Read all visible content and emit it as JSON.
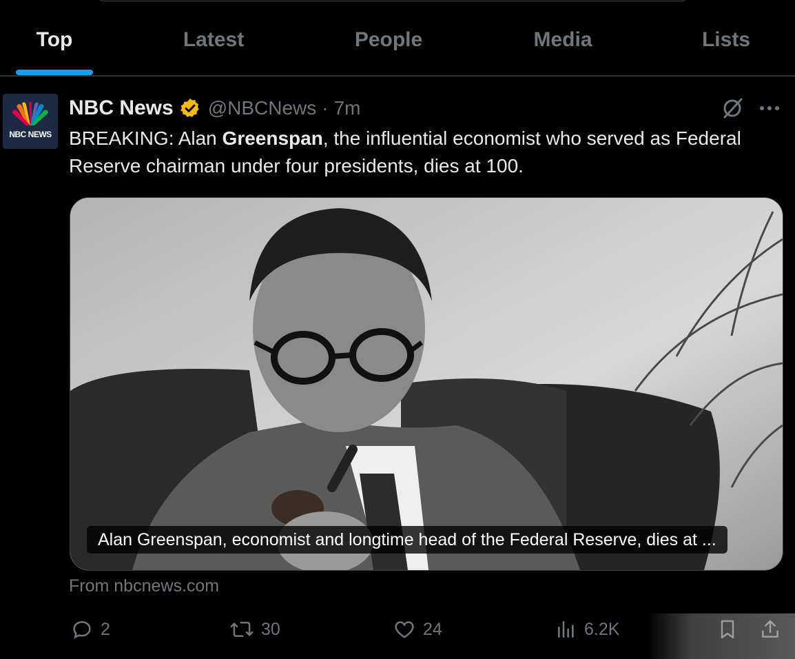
{
  "tabs": [
    {
      "label": "Top",
      "active": true
    },
    {
      "label": "Latest",
      "active": false
    },
    {
      "label": "People",
      "active": false
    },
    {
      "label": "Media",
      "active": false
    },
    {
      "label": "Lists",
      "active": false
    }
  ],
  "tweet": {
    "avatar_text": "NBC NEWS",
    "display_name": "NBC News",
    "verified_icon": "verified-gold-badge",
    "handle": "@NBCNews",
    "separator": "·",
    "time": "7m",
    "text_parts": {
      "prefix": "BREAKING: Alan ",
      "bold": "Greenspan",
      "suffix": ", the influential economist who served as Federal Reserve chairman under four presidents, dies at 100."
    },
    "card": {
      "caption": "Alan Greenspan, economist and longtime head of the Federal Reserve, dies at ..."
    },
    "source": "From nbcnews.com",
    "actions": {
      "replies": "2",
      "reposts": "30",
      "likes": "24",
      "views": "6.2K"
    }
  },
  "colors": {
    "accent": "#1d9bf0",
    "muted": "#71767b",
    "text": "#e7e9ea",
    "verified": "#f4b912"
  }
}
